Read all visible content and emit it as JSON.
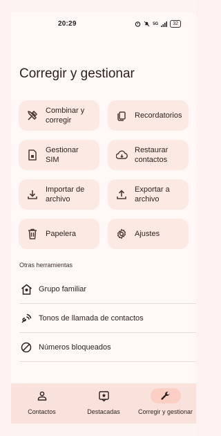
{
  "status": {
    "time": "20:29",
    "signal": "5G",
    "battery": "32"
  },
  "page": {
    "title": "Corregir y gestionar"
  },
  "actions": [
    {
      "label": "Combinar y corregir",
      "icon": "tools-icon"
    },
    {
      "label": "Recordatorios",
      "icon": "copy-icon"
    },
    {
      "label": "Gestionar SIM",
      "icon": "sim-icon"
    },
    {
      "label": "Restaurar contactos",
      "icon": "cloud-download-icon"
    },
    {
      "label": "Importar de archivo",
      "icon": "download-icon"
    },
    {
      "label": "Exportar a archivo",
      "icon": "upload-icon"
    },
    {
      "label": "Papelera",
      "icon": "trash-icon"
    },
    {
      "label": "Ajustes",
      "icon": "settings-icon"
    }
  ],
  "other_tools": {
    "section_label": "Otras herramientas",
    "items": [
      {
        "label": "Grupo familiar",
        "icon": "family-home-icon"
      },
      {
        "label": "Tonos de llamada de contactos",
        "icon": "ringtone-icon"
      },
      {
        "label": "Números bloqueados",
        "icon": "block-icon"
      }
    ]
  },
  "bottom_nav": {
    "items": [
      {
        "label": "Contactos",
        "icon": "person-icon",
        "active": false
      },
      {
        "label": "Destacadas",
        "icon": "star-icon",
        "active": false
      },
      {
        "label": "Corregir y gestionar",
        "icon": "wrench-icon",
        "active": true
      }
    ]
  },
  "colors": {
    "background": "#fff8f6",
    "card": "#fce9e4",
    "nav_bar": "#f9e2dc",
    "active_pill": "#fccfc5",
    "text": "#2b1f1c"
  }
}
